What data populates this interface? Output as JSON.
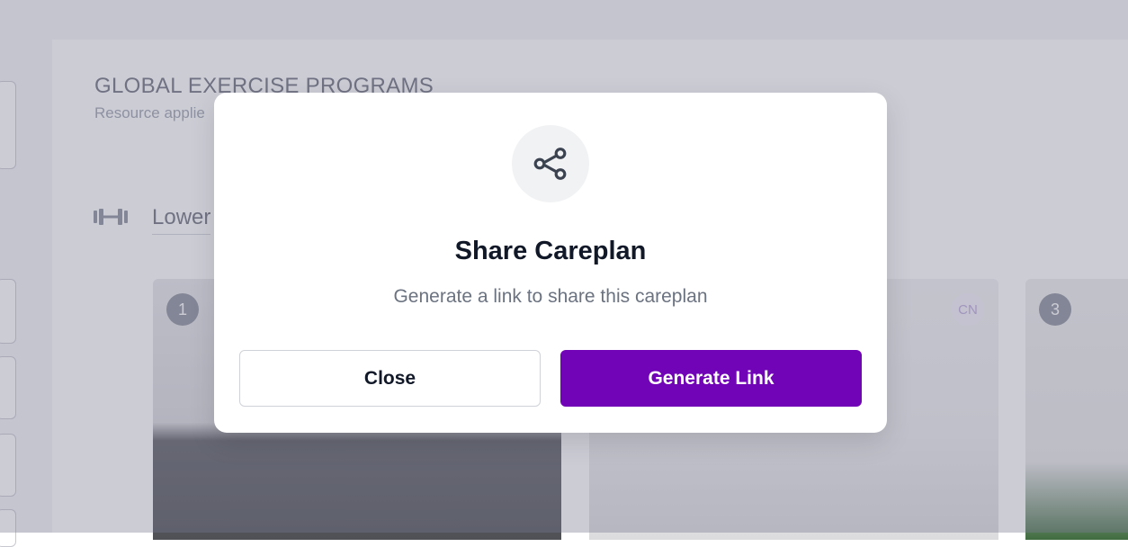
{
  "background": {
    "section_title": "GLOBAL EXERCISE PROGRAMS",
    "section_subtitle": "Resource applie",
    "category_label": "Lower",
    "cards": [
      {
        "badge": "1"
      },
      {
        "badge": "CN"
      },
      {
        "badge": "3"
      }
    ]
  },
  "modal": {
    "icon": "share-icon",
    "title": "Share Careplan",
    "description": "Generate a link to share this careplan",
    "close_label": "Close",
    "generate_label": "Generate Link"
  },
  "colors": {
    "primary": "#7204b8",
    "overlay": "rgba(120,120,145,0.38)"
  }
}
